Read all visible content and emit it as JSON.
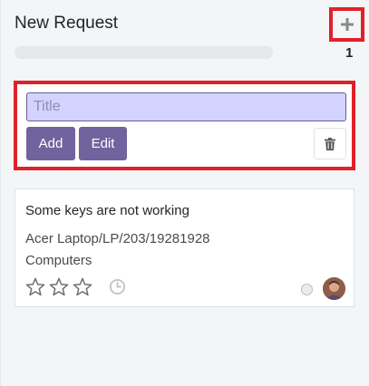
{
  "column": {
    "title": "New Request",
    "count": "1",
    "add_icon": "plus-icon"
  },
  "quick_create": {
    "title_placeholder": "Title",
    "title_value": "",
    "add_label": "Add",
    "edit_label": "Edit",
    "delete_icon": "trash-icon"
  },
  "card": {
    "title": "Some keys are not working",
    "equipment": "Acer Laptop/LP/203/19281928",
    "category": "Computers",
    "priority_stars": 0,
    "priority_max": 3,
    "activity_icon": "clock-icon",
    "state_icon": "status-circle-icon",
    "avatar_icon": "user-avatar"
  },
  "colors": {
    "primary": "#71639e",
    "highlight": "#e0202a",
    "input_bg": "#d2d3ff"
  }
}
